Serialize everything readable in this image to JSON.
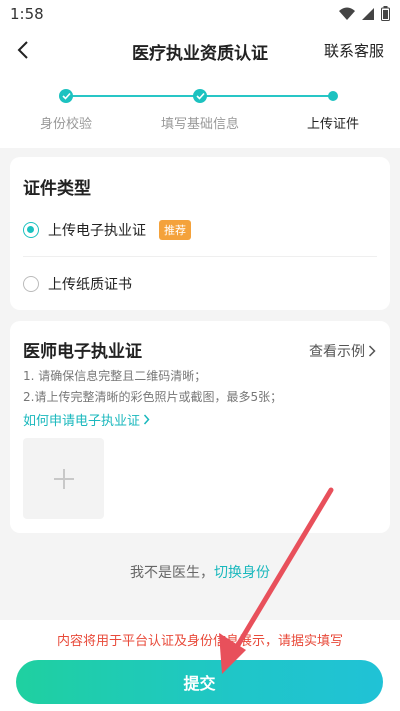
{
  "status_bar": {
    "time": "1:58"
  },
  "nav": {
    "title": "医疗执业资质认证",
    "right_action": "联系客服"
  },
  "stepper": {
    "steps": [
      {
        "label": "身份校验",
        "state": "done"
      },
      {
        "label": "填写基础信息",
        "state": "done"
      },
      {
        "label": "上传证件",
        "state": "current"
      }
    ]
  },
  "certificate_type": {
    "title": "证件类型",
    "options": [
      {
        "label": "上传电子执业证",
        "badge": "推荐",
        "selected": true
      },
      {
        "label": "上传纸质证书",
        "selected": false
      }
    ]
  },
  "electronic_license": {
    "title": "医师电子执业证",
    "example_link": "查看示例",
    "tips": [
      "1. 请确保信息完整且二维码清晰；",
      "2.请上传完整清晰的彩色照片或截图，最多5张；"
    ],
    "apply_link": "如何申请电子执业证"
  },
  "switch_identity": {
    "text": "我不是医生，",
    "link": "切换身份"
  },
  "footer": {
    "notice": "内容将用于平台认证及身份信息展示，请据实填写",
    "submit_label": "提交"
  },
  "colors": {
    "accent": "#1cc2c0",
    "badge": "#f4a23b",
    "warning": "#e84a3a",
    "annotation_arrow": "#e8505b"
  },
  "icons": [
    "back-icon",
    "wifi-icon",
    "signal-icon",
    "battery-icon",
    "chevron-right-icon",
    "plus-icon"
  ]
}
